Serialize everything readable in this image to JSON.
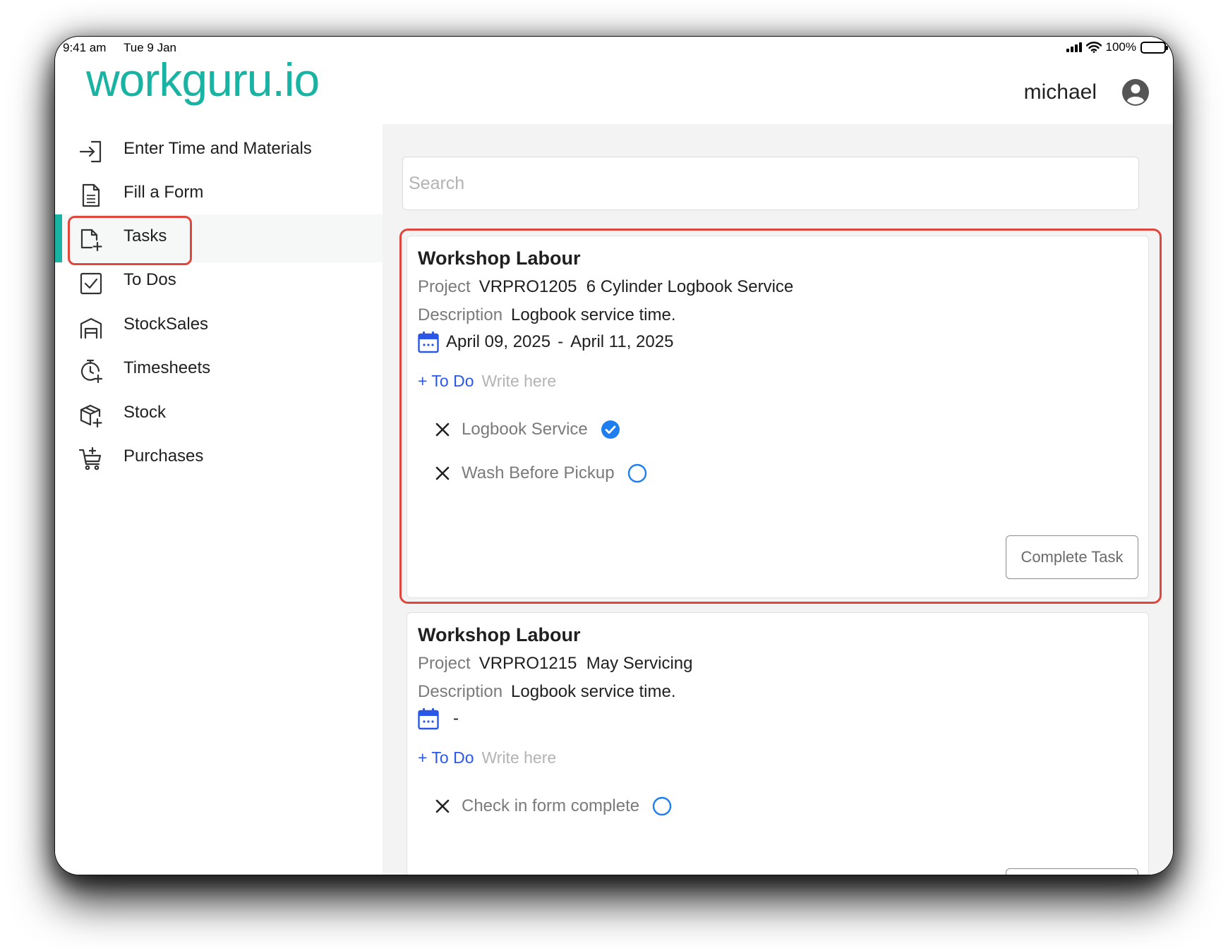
{
  "status_bar": {
    "time": "9:41 am",
    "date": "Tue 9 Jan",
    "battery": "100%",
    "battery_level": 1.0
  },
  "header": {
    "logo": "workguru.io",
    "user": "michael"
  },
  "sidebar": {
    "items": [
      {
        "label": "Enter Time and Materials",
        "icon": "enter-icon"
      },
      {
        "label": "Fill a Form",
        "icon": "form-icon"
      },
      {
        "label": "Tasks",
        "icon": "tasks-icon",
        "active": true
      },
      {
        "label": "To Dos",
        "icon": "checkbox-icon"
      },
      {
        "label": "StockSales",
        "icon": "store-icon"
      },
      {
        "label": "Timesheets",
        "icon": "stopwatch-icon"
      },
      {
        "label": "Stock",
        "icon": "package-icon"
      },
      {
        "label": "Purchases",
        "icon": "cart-icon"
      }
    ]
  },
  "search": {
    "placeholder": "Search"
  },
  "tasks": [
    {
      "title": "Workshop Labour",
      "project_label": "Project",
      "project": "VRPRO1205  6 Cylinder Logbook Service",
      "description_label": "Description",
      "description": "Logbook service time.",
      "start_date": "April 09, 2025",
      "separator": "-",
      "end_date": "April 11, 2025",
      "todo_add": "+ To Do",
      "todo_placeholder": "Write here",
      "todos": [
        {
          "label": "Logbook Service",
          "done": true
        },
        {
          "label": "Wash Before Pickup",
          "done": false
        }
      ],
      "complete_label": "Complete Task"
    },
    {
      "title": "Workshop Labour",
      "project_label": "Project",
      "project": "VRPRO1215  May Servicing",
      "description_label": "Description",
      "description": "Logbook service time.",
      "start_date": "",
      "separator": "-",
      "end_date": "",
      "todo_add": "+ To Do",
      "todo_placeholder": "Write here",
      "todos": [
        {
          "label": "Check in form complete",
          "done": false
        }
      ],
      "complete_label": ""
    }
  ],
  "colors": {
    "brand": "#19b3a4",
    "accent_blue": "#2b57e6",
    "check_blue": "#1e7ef0",
    "highlight_red": "#e0463c"
  }
}
